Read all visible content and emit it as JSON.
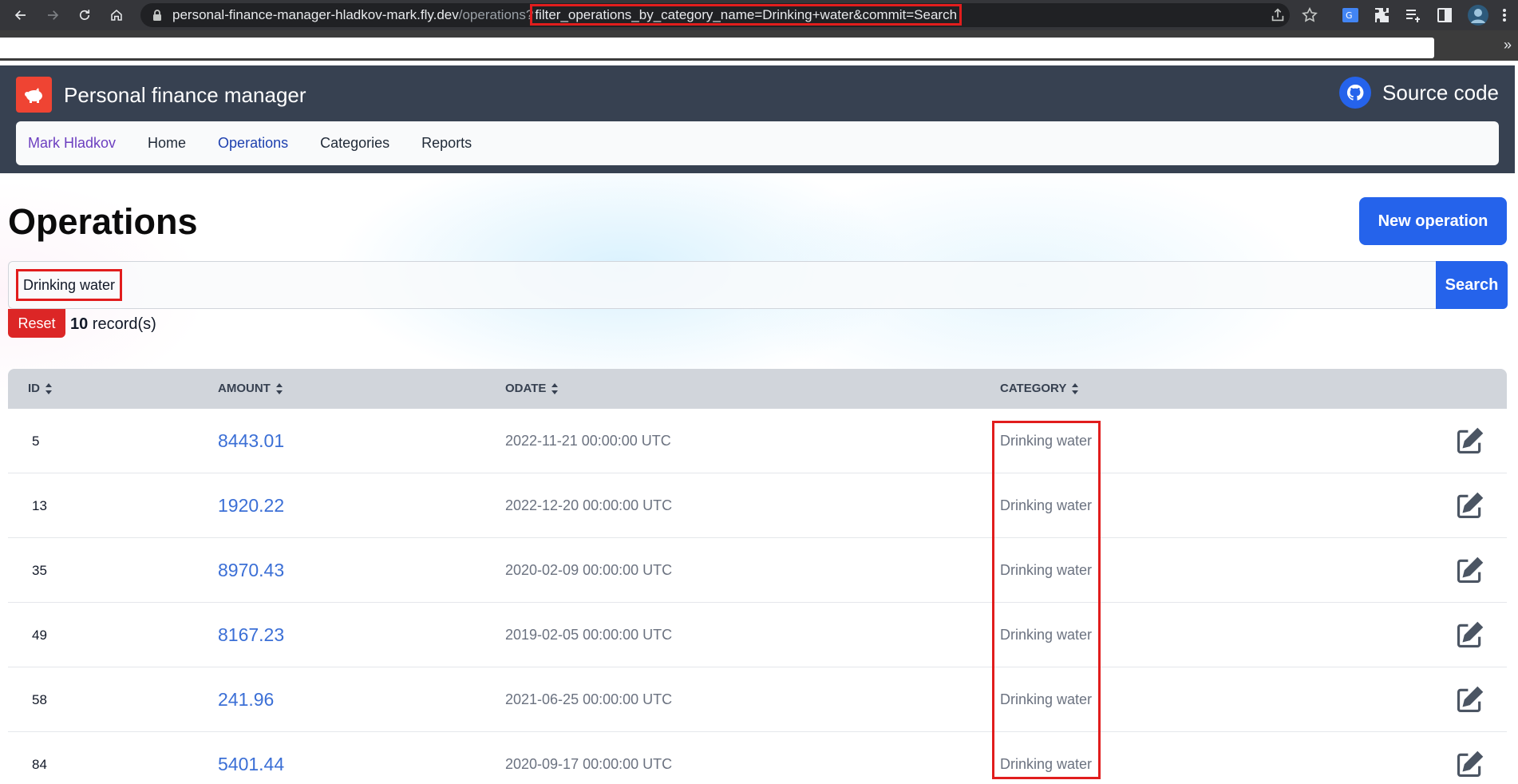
{
  "browser": {
    "url_host": "personal-finance-manager-hladkov-mark.fly.dev",
    "url_path": "/operations?",
    "url_query": "filter_operations_by_category_name=Drinking+water&commit=Search",
    "bookmarks_more": "»"
  },
  "app": {
    "title": "Personal finance manager",
    "source_code_label": "Source code",
    "nav": {
      "user": "Mark Hladkov",
      "home": "Home",
      "operations": "Operations",
      "categories": "Categories",
      "reports": "Reports"
    }
  },
  "page": {
    "title": "Operations",
    "new_button": "New operation",
    "search_value": "Drinking water",
    "search_button": "Search",
    "reset_button": "Reset",
    "record_count": "10",
    "record_suffix": " record(s)"
  },
  "table": {
    "headers": {
      "id": "ID",
      "amount": "AMOUNT",
      "odate": "ODATE",
      "category": "CATEGORY"
    },
    "rows": [
      {
        "id": "5",
        "amount": "8443.01",
        "odate": "2022-11-21 00:00:00 UTC",
        "category": "Drinking water"
      },
      {
        "id": "13",
        "amount": "1920.22",
        "odate": "2022-12-20 00:00:00 UTC",
        "category": "Drinking water"
      },
      {
        "id": "35",
        "amount": "8970.43",
        "odate": "2020-02-09 00:00:00 UTC",
        "category": "Drinking water"
      },
      {
        "id": "49",
        "amount": "8167.23",
        "odate": "2019-02-05 00:00:00 UTC",
        "category": "Drinking water"
      },
      {
        "id": "58",
        "amount": "241.96",
        "odate": "2021-06-25 00:00:00 UTC",
        "category": "Drinking water"
      },
      {
        "id": "84",
        "amount": "5401.44",
        "odate": "2020-09-17 00:00:00 UTC",
        "category": "Drinking water"
      }
    ]
  },
  "colors": {
    "header_bg": "#374151",
    "primary": "#2563eb",
    "danger": "#dc2626",
    "logo": "#ef4433",
    "highlight": "#e11d1d"
  }
}
